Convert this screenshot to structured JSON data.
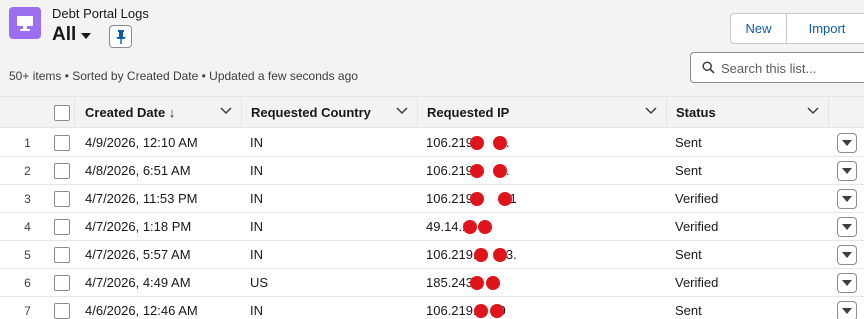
{
  "header": {
    "object_name": "Debt Portal Logs",
    "view_name": "All",
    "summary": "50+ items • Sorted by Created Date • Updated a few seconds ago",
    "app_icon": "monitor-icon",
    "pin_icon": "pin-icon",
    "brand_color": "#9b6ff0"
  },
  "actions": {
    "new_label": "New",
    "import_label": "Import"
  },
  "search": {
    "placeholder": "Search this list..."
  },
  "table": {
    "columns": [
      "Created Date ↓",
      "Requested Country",
      "Requested IP",
      "Status"
    ],
    "rows": [
      {
        "num": "1",
        "created": "4/9/2026, 12:10 AM",
        "country": "IN",
        "ip": "106.219.",
        "ip_tail": "0.",
        "status": "Sent"
      },
      {
        "num": "2",
        "created": "4/8/2026, 6:51 AM",
        "country": "IN",
        "ip": "106.219.",
        "ip_tail": "0.",
        "status": "Sent"
      },
      {
        "num": "3",
        "created": "4/7/2026, 11:53 PM",
        "country": "IN",
        "ip": "106.219.",
        "ip_tail": "1.1",
        "status": "Verified"
      },
      {
        "num": "4",
        "created": "4/7/2026, 1:18 PM",
        "country": "IN",
        "ip": "49.14.1",
        "ip_tail": "",
        "status": "Verified"
      },
      {
        "num": "5",
        "created": "4/7/2026, 5:57 AM",
        "country": "IN",
        "ip": "106.219.1",
        "ip_tail": "3.",
        "status": "Sent"
      },
      {
        "num": "6",
        "created": "4/7/2026, 4:49 AM",
        "country": "US",
        "ip": "185.243.",
        "ip_tail": "",
        "status": "Verified"
      },
      {
        "num": "7",
        "created": "4/6/2026, 12:46 AM",
        "country": "IN",
        "ip": "106.219.",
        "ip_tail": "9",
        "status": "Sent"
      }
    ]
  }
}
